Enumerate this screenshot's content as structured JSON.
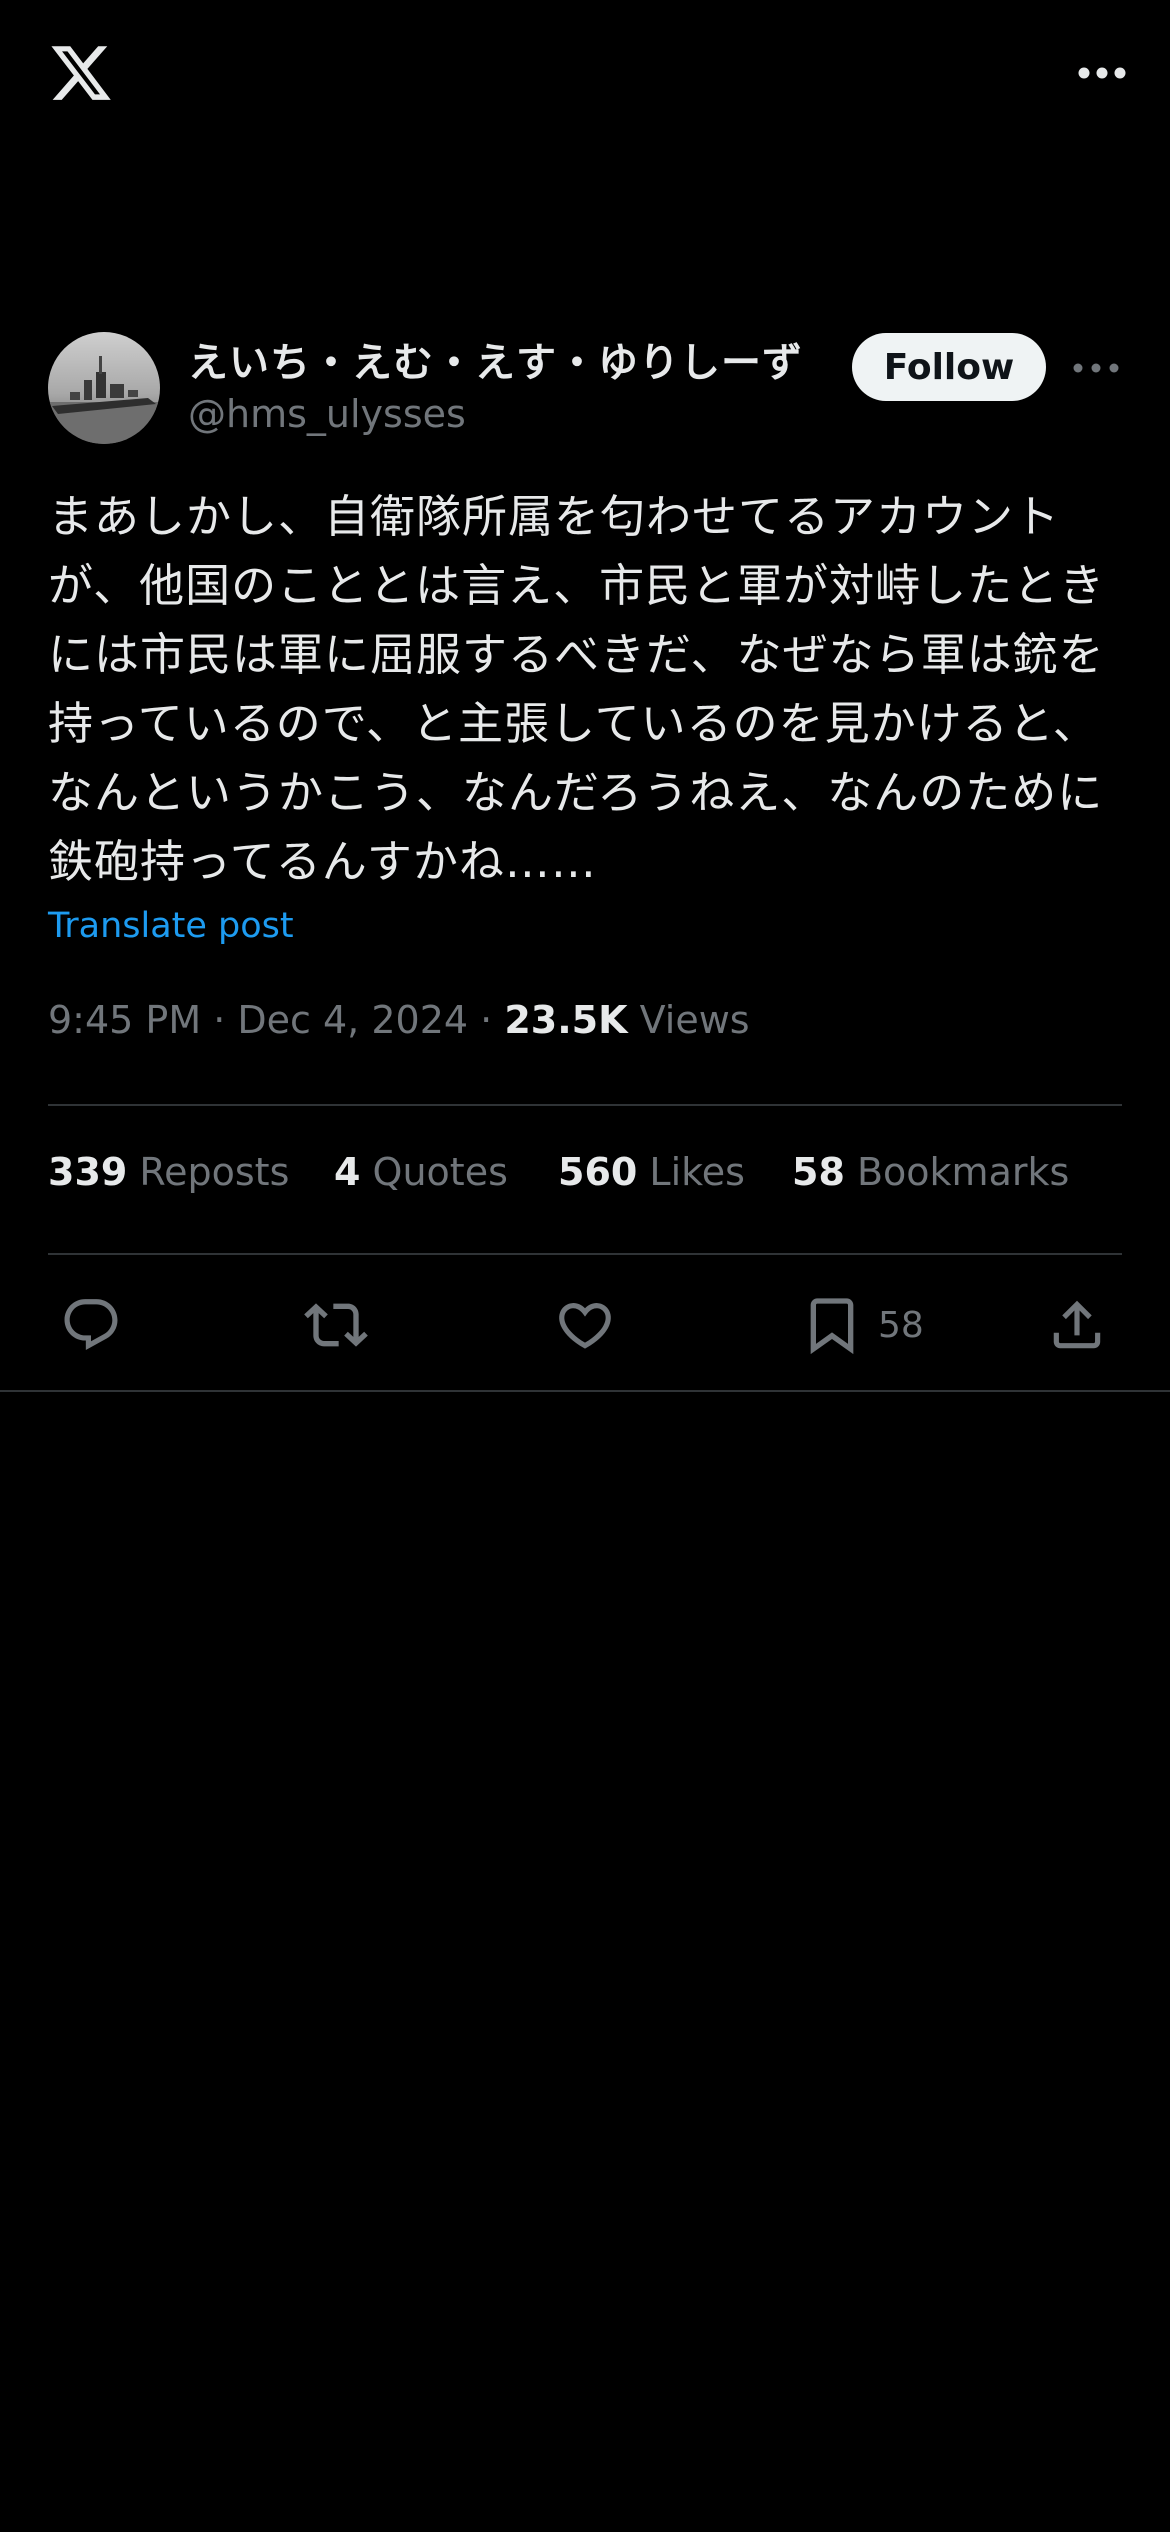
{
  "header": {
    "logo_icon": "x-logo-icon",
    "more_icon": "more-horizontal-icon"
  },
  "author": {
    "display_name": "えいち・えむ・えす・ゆりしーず",
    "handle": "@hms_ulysses",
    "follow_label": "Follow",
    "avatar_icon": "warship-avatar"
  },
  "post": {
    "text": "まあしかし、自衛隊所属を匂わせてるアカウントが、他国のこととは言え、市民と軍が対峙したときには市民は軍に屈服するべきだ、なぜなら軍は銃を持っているので、と主張しているのを見かけると、なんというかこう、なんだろうねえ、なんのために鉄砲持ってるんすかね……",
    "translate_label": "Translate post",
    "time": "9:45 PM",
    "date": "Dec 4, 2024",
    "views_count": "23.5K",
    "views_label": "Views"
  },
  "stats": {
    "reposts_count": "339",
    "reposts_label": "Reposts",
    "quotes_count": "4",
    "quotes_label": "Quotes",
    "likes_count": "560",
    "likes_label": "Likes",
    "bookmarks_count": "58",
    "bookmarks_label": "Bookmarks"
  },
  "actions": {
    "reply_icon": "reply-icon",
    "repost_icon": "repost-icon",
    "like_icon": "heart-icon",
    "bookmark_icon": "bookmark-icon",
    "bookmark_count": "58",
    "share_icon": "share-icon"
  },
  "colors": {
    "background": "#000000",
    "text_primary": "#e7e9ea",
    "text_secondary": "#71767b",
    "link": "#1d9bf0",
    "divider": "#2f3336",
    "follow_bg": "#eff3f4"
  }
}
